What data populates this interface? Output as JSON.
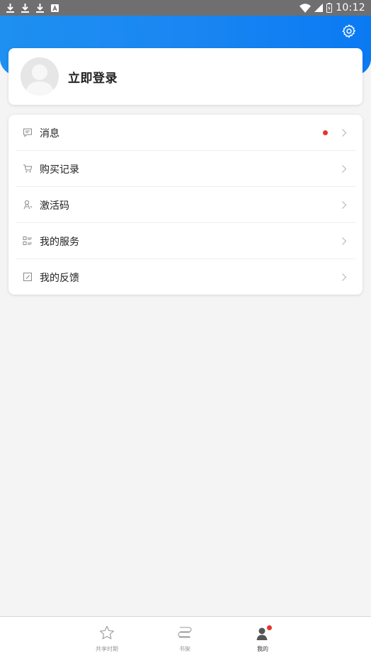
{
  "status_bar": {
    "time": "10:12"
  },
  "profile": {
    "login_label": "立即登录"
  },
  "menu": {
    "items": [
      {
        "label": "消息",
        "icon": "message-icon",
        "badge": "red-dot"
      },
      {
        "label": "购买记录",
        "icon": "cart-icon"
      },
      {
        "label": "激活码",
        "icon": "activation-icon"
      },
      {
        "label": "我的服务",
        "icon": "services-icon"
      },
      {
        "label": "我的反馈",
        "icon": "feedback-icon"
      }
    ]
  },
  "bottom_nav": {
    "items": [
      {
        "label": "共享时期",
        "icon": "star-icon"
      },
      {
        "label": "书架",
        "icon": "bookshelf-icon"
      },
      {
        "label": "我的",
        "icon": "profile-icon",
        "active": true
      }
    ]
  },
  "colors": {
    "header_gradient_start": "#1e90f1",
    "header_gradient_end": "#0a7af3",
    "status_bar": "#6f6f6f",
    "background": "#f4f4f4",
    "badge_red": "#e8332d"
  }
}
